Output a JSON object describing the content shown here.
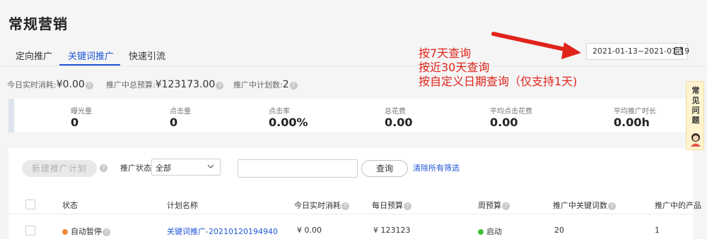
{
  "page": {
    "title": "常规营销"
  },
  "tabs": [
    {
      "label": "定向推广",
      "active": false
    },
    {
      "label": "关键词推广",
      "active": true
    },
    {
      "label": "快速引流",
      "active": false
    }
  ],
  "date_range": {
    "value": "2021-01-13~2021-01-19",
    "icon": "calendar-icon"
  },
  "stats_line": {
    "today_spend_label": "今日实时消耗:",
    "today_spend_value": "¥0.00",
    "total_budget_label": "推广中总预算:",
    "total_budget_value": "¥123173.00",
    "plan_count_label": "推广中计划数:",
    "plan_count_value": "2",
    "help_glyph": "?"
  },
  "metrics": [
    {
      "label": "曝光量",
      "value": "0"
    },
    {
      "label": "点击量",
      "value": "0"
    },
    {
      "label": "点击率",
      "value": "0.00%"
    },
    {
      "label": "总花费",
      "value": "0.00"
    },
    {
      "label": "平均点击花费",
      "value": "0.00"
    },
    {
      "label": "平均推广时长",
      "value": "0.00h"
    }
  ],
  "toolbar": {
    "new_plan_label": "新建推广计划",
    "status_filter_label": "推广状态:",
    "status_filter_value": "全部",
    "search_placeholder": "",
    "query_label": "查询",
    "clear_filters_label": "清除所有筛选"
  },
  "table": {
    "headers": [
      "状态",
      "计划名称",
      "今日实时消耗",
      "每日预算",
      "周预算",
      "推广中关键词数",
      "推广中的产品"
    ],
    "rows": [
      {
        "status": "自动暂停",
        "status_color": "#f08a3c",
        "name": "关键词推广-20210120194940",
        "today_spend": "¥ 0.00",
        "daily_budget": "¥ 123123",
        "weekly_budget": "启动",
        "weekly_color": "#3fbf3f",
        "keywords": "20",
        "products": "1"
      }
    ]
  },
  "annotation": {
    "lines": [
      "按7天查询",
      "按近30天查询",
      "按自定义日期查询（仅支持1天)"
    ],
    "color": "#e0241b"
  },
  "helper": {
    "label": "常见问题"
  },
  "colors": {
    "accent": "#1f56d6",
    "annotation": "#e0241b"
  }
}
